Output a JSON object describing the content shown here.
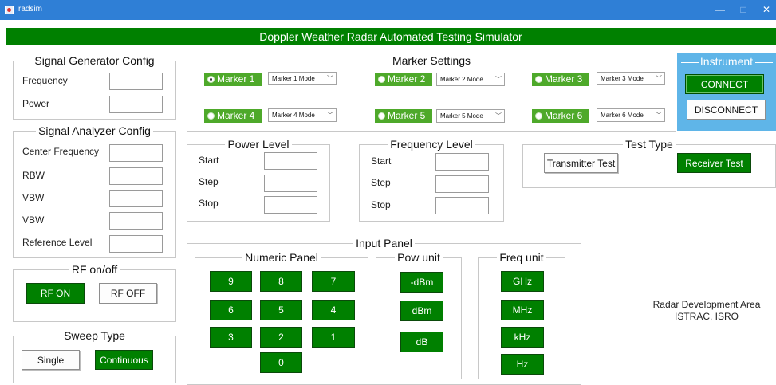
{
  "window": {
    "app_title": "radsim",
    "minimize": "—",
    "maximize": "□",
    "close": "✕"
  },
  "banner": "Doppler Weather Radar Automated Testing Simulator",
  "signal_generator": {
    "legend": "Signal Generator Config",
    "frequency_label": "Frequency",
    "power_label": "Power",
    "frequency_value": "",
    "power_value": ""
  },
  "signal_analyzer": {
    "legend": "Signal Analyzer Config",
    "center_frequency_label": "Center Frequency",
    "rbw_label": "RBW",
    "vbw_label": "VBW",
    "vbw2_label": "VBW",
    "reference_level_label": "Reference Level"
  },
  "rf": {
    "legend": "RF on/off",
    "on": "RF ON",
    "off": "RF OFF"
  },
  "sweep": {
    "legend": "Sweep Type",
    "single": "Single",
    "continuous": "Continuous"
  },
  "markers": {
    "legend": "Marker Settings",
    "items": [
      {
        "label": "Marker 1",
        "mode": "Marker 1 Mode",
        "selected": true
      },
      {
        "label": "Marker 2",
        "mode": "Marker 2 Mode",
        "selected": false
      },
      {
        "label": "Marker 3",
        "mode": "Marker 3 Mode",
        "selected": false
      },
      {
        "label": "Marker 4",
        "mode": "Marker 4 Mode",
        "selected": false
      },
      {
        "label": "Marker 5",
        "mode": "Marker 5 Mode",
        "selected": false
      },
      {
        "label": "Marker 6",
        "mode": "Marker 6 Mode",
        "selected": false
      }
    ]
  },
  "instrument": {
    "legend": "Instrument",
    "connect": "CONNECT",
    "disconnect": "DISCONNECT"
  },
  "power_level": {
    "legend": "Power Level",
    "start": "Start",
    "step": "Step",
    "stop": "Stop"
  },
  "frequency_level": {
    "legend": "Frequency Level",
    "start": "Start",
    "step": "Step",
    "stop": "Stop"
  },
  "test_type": {
    "legend": "Test Type",
    "transmitter": "Transmitter Test",
    "receiver": "Receiver Test"
  },
  "input_panel": {
    "legend": "Input Panel",
    "numeric": {
      "legend": "Numeric Panel",
      "keys": [
        "9",
        "8",
        "7",
        "6",
        "5",
        "4",
        "3",
        "2",
        "1",
        "0"
      ]
    },
    "pow_unit": {
      "legend": "Pow unit",
      "units": [
        "-dBm",
        "dBm",
        "dB"
      ]
    },
    "freq_unit": {
      "legend": "Freq unit",
      "units": [
        "GHz",
        "MHz",
        "kHz",
        "Hz"
      ]
    }
  },
  "footer": {
    "line1": "Radar Development Area",
    "line2": "ISTRAC, ISRO"
  },
  "colors": {
    "titlebar": "#2f7fd6",
    "banner": "#008000",
    "button_green": "#008000",
    "marker_green": "#4ea92a",
    "instrument_bg": "#5fb5e8"
  }
}
